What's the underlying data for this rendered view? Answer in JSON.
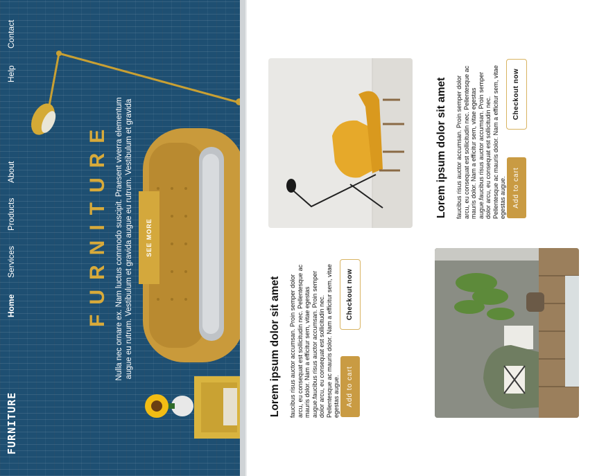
{
  "brand": {
    "logo": "FURNITURE"
  },
  "nav": {
    "items": [
      {
        "label": "Home",
        "active": true
      },
      {
        "label": "Services"
      },
      {
        "label": "Products"
      },
      {
        "label": "About"
      },
      {
        "label": "Help"
      },
      {
        "label": "Contact"
      }
    ]
  },
  "hero": {
    "title": "FURNITURE",
    "description": "Nulla nec ornare ex. Nam luctus commodo suscipit. Praesent viverra elementum augue eu rutrum. Vestibulum et gravida augue eu rutrum. Vestibulum et gravida",
    "cta_label": "SEE MORE"
  },
  "products": [
    {
      "title": "Lorem ipsum dolor sit amet",
      "description": "faucibus risus auctor accumsan. Proin semper dolor arcu, eu consequat est sollicitudin nec. Pellentesque ac mauris dolor. Nam a efficitur sem, vitae egestas augue.faucibus risus auctor accumsan. Proin semper dolor arcu, eu consequat est sollicitudin nec. Pellentesque ac mauris dolor. Nam a efficitur sem, vitae egestas augue.",
      "add_to_cart_label": "Add to cart",
      "checkout_label": "Checkout now"
    },
    {
      "title": "Lorem ipsum dolor sit amet",
      "description": "faucibus risus auctor accumsan. Proin semper dolor arcu, eu consequat est sollicitudin nec. Pellentesque ac mauris dolor. Nam a efficitur sem, vitae egestas augue.faucibus risus auctor accumsan. Proin semper dolor arcu, eu consequat est sollicitudin nec. Pellentesque ac mauris dolor. Nam a efficitur sem, vitae egestas augue.",
      "add_to_cart_label": "Add to cart",
      "checkout_label": "Checkout now"
    }
  ],
  "colors": {
    "hero_background": "#1e4f72",
    "accent_gold": "#d4a83c",
    "button_gold": "#c99b43"
  }
}
